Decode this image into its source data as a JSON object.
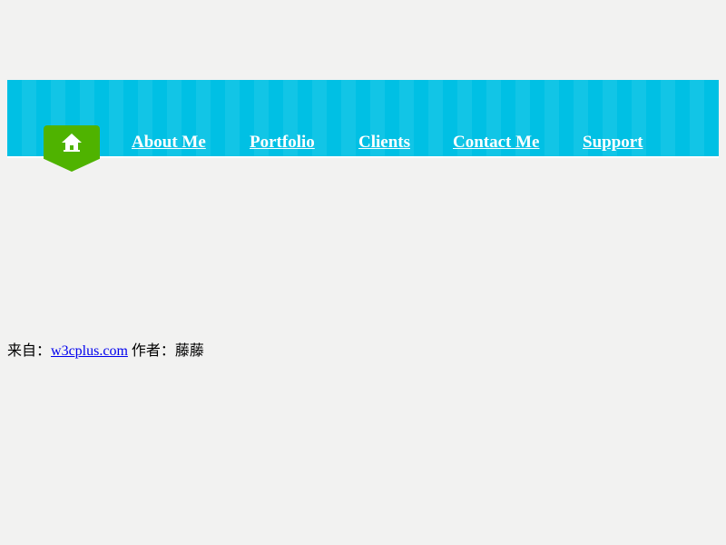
{
  "nav": {
    "home_icon": "home-icon",
    "items": [
      {
        "label": "About Me"
      },
      {
        "label": "Portfolio"
      },
      {
        "label": "Clients"
      },
      {
        "label": "Contact Me"
      },
      {
        "label": "Support"
      }
    ],
    "colors": {
      "bar": "#00c0e4",
      "bar_stripe": "#12c5e6",
      "home_tab": "#4fb300",
      "text": "#ffffff"
    }
  },
  "credit": {
    "from_label": "来自：",
    "source_link": "w3cplus.com",
    "author_label": "作者：",
    "author_name": "藤藤"
  }
}
